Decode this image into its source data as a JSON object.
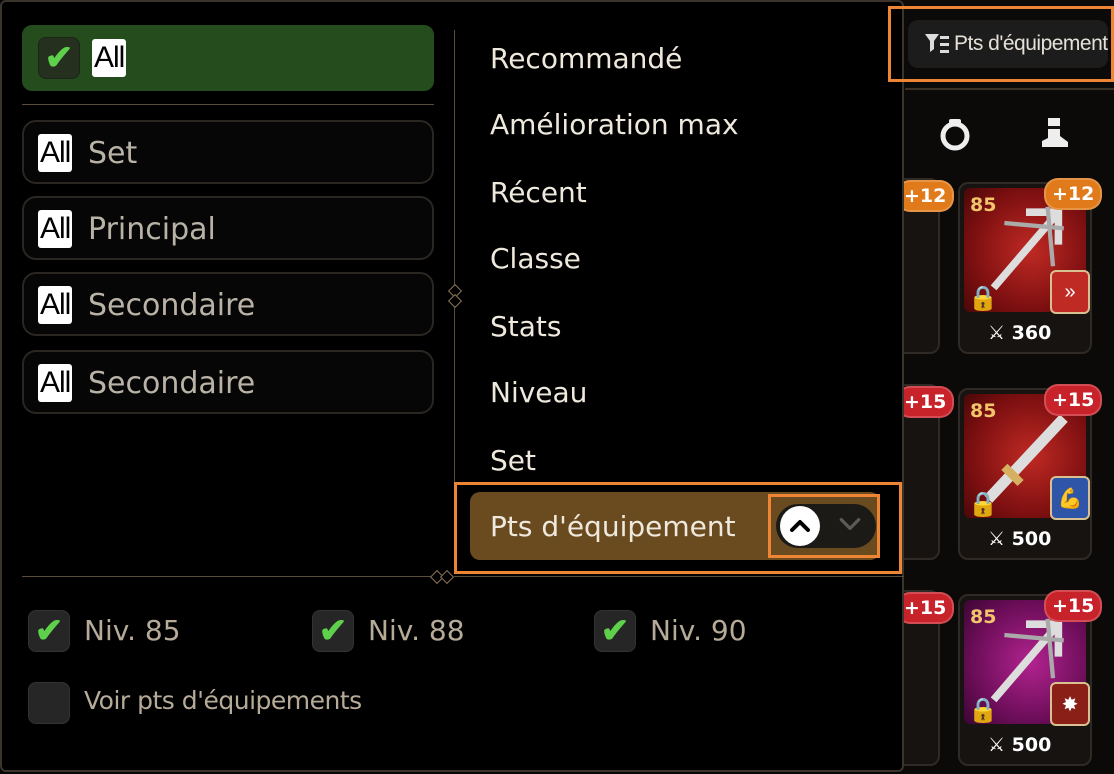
{
  "sort_chip": {
    "label": "Pts d'équipement",
    "icon": "filter-sort-icon"
  },
  "tabs": [
    {
      "icon": "ring-icon"
    },
    {
      "icon": "boots-icon"
    }
  ],
  "filters": {
    "all_label": "All",
    "rows": [
      {
        "tag": "All",
        "label": "Set"
      },
      {
        "tag": "All",
        "label": "Principal"
      },
      {
        "tag": "All",
        "label": "Secondaire"
      },
      {
        "tag": "All",
        "label": "Secondaire"
      }
    ]
  },
  "sort_options": [
    "Recommandé",
    "Amélioration max",
    "Récent",
    "Classe",
    "Stats",
    "Niveau",
    "Set",
    "Pts d'équipement"
  ],
  "levels": [
    {
      "label": "Niv. 85",
      "checked": true
    },
    {
      "label": "Niv. 88",
      "checked": true
    },
    {
      "label": "Niv. 90",
      "checked": true
    }
  ],
  "show_points": {
    "label": "Voir pts d'équipements",
    "checked": false
  },
  "gear": [
    {
      "level": "85",
      "plus": "+12",
      "stat": "360",
      "color": "red"
    },
    {
      "level": "85",
      "plus": "+15",
      "stat": "500",
      "color": "red"
    },
    {
      "level": "85",
      "plus": "+15",
      "stat": "500",
      "color": "purple"
    }
  ],
  "partial_badges": [
    "+12",
    "+15",
    "+15"
  ],
  "colors": {
    "accent": "#ee8535",
    "selected": "#6a4b20",
    "all_green": "#244c1c"
  }
}
